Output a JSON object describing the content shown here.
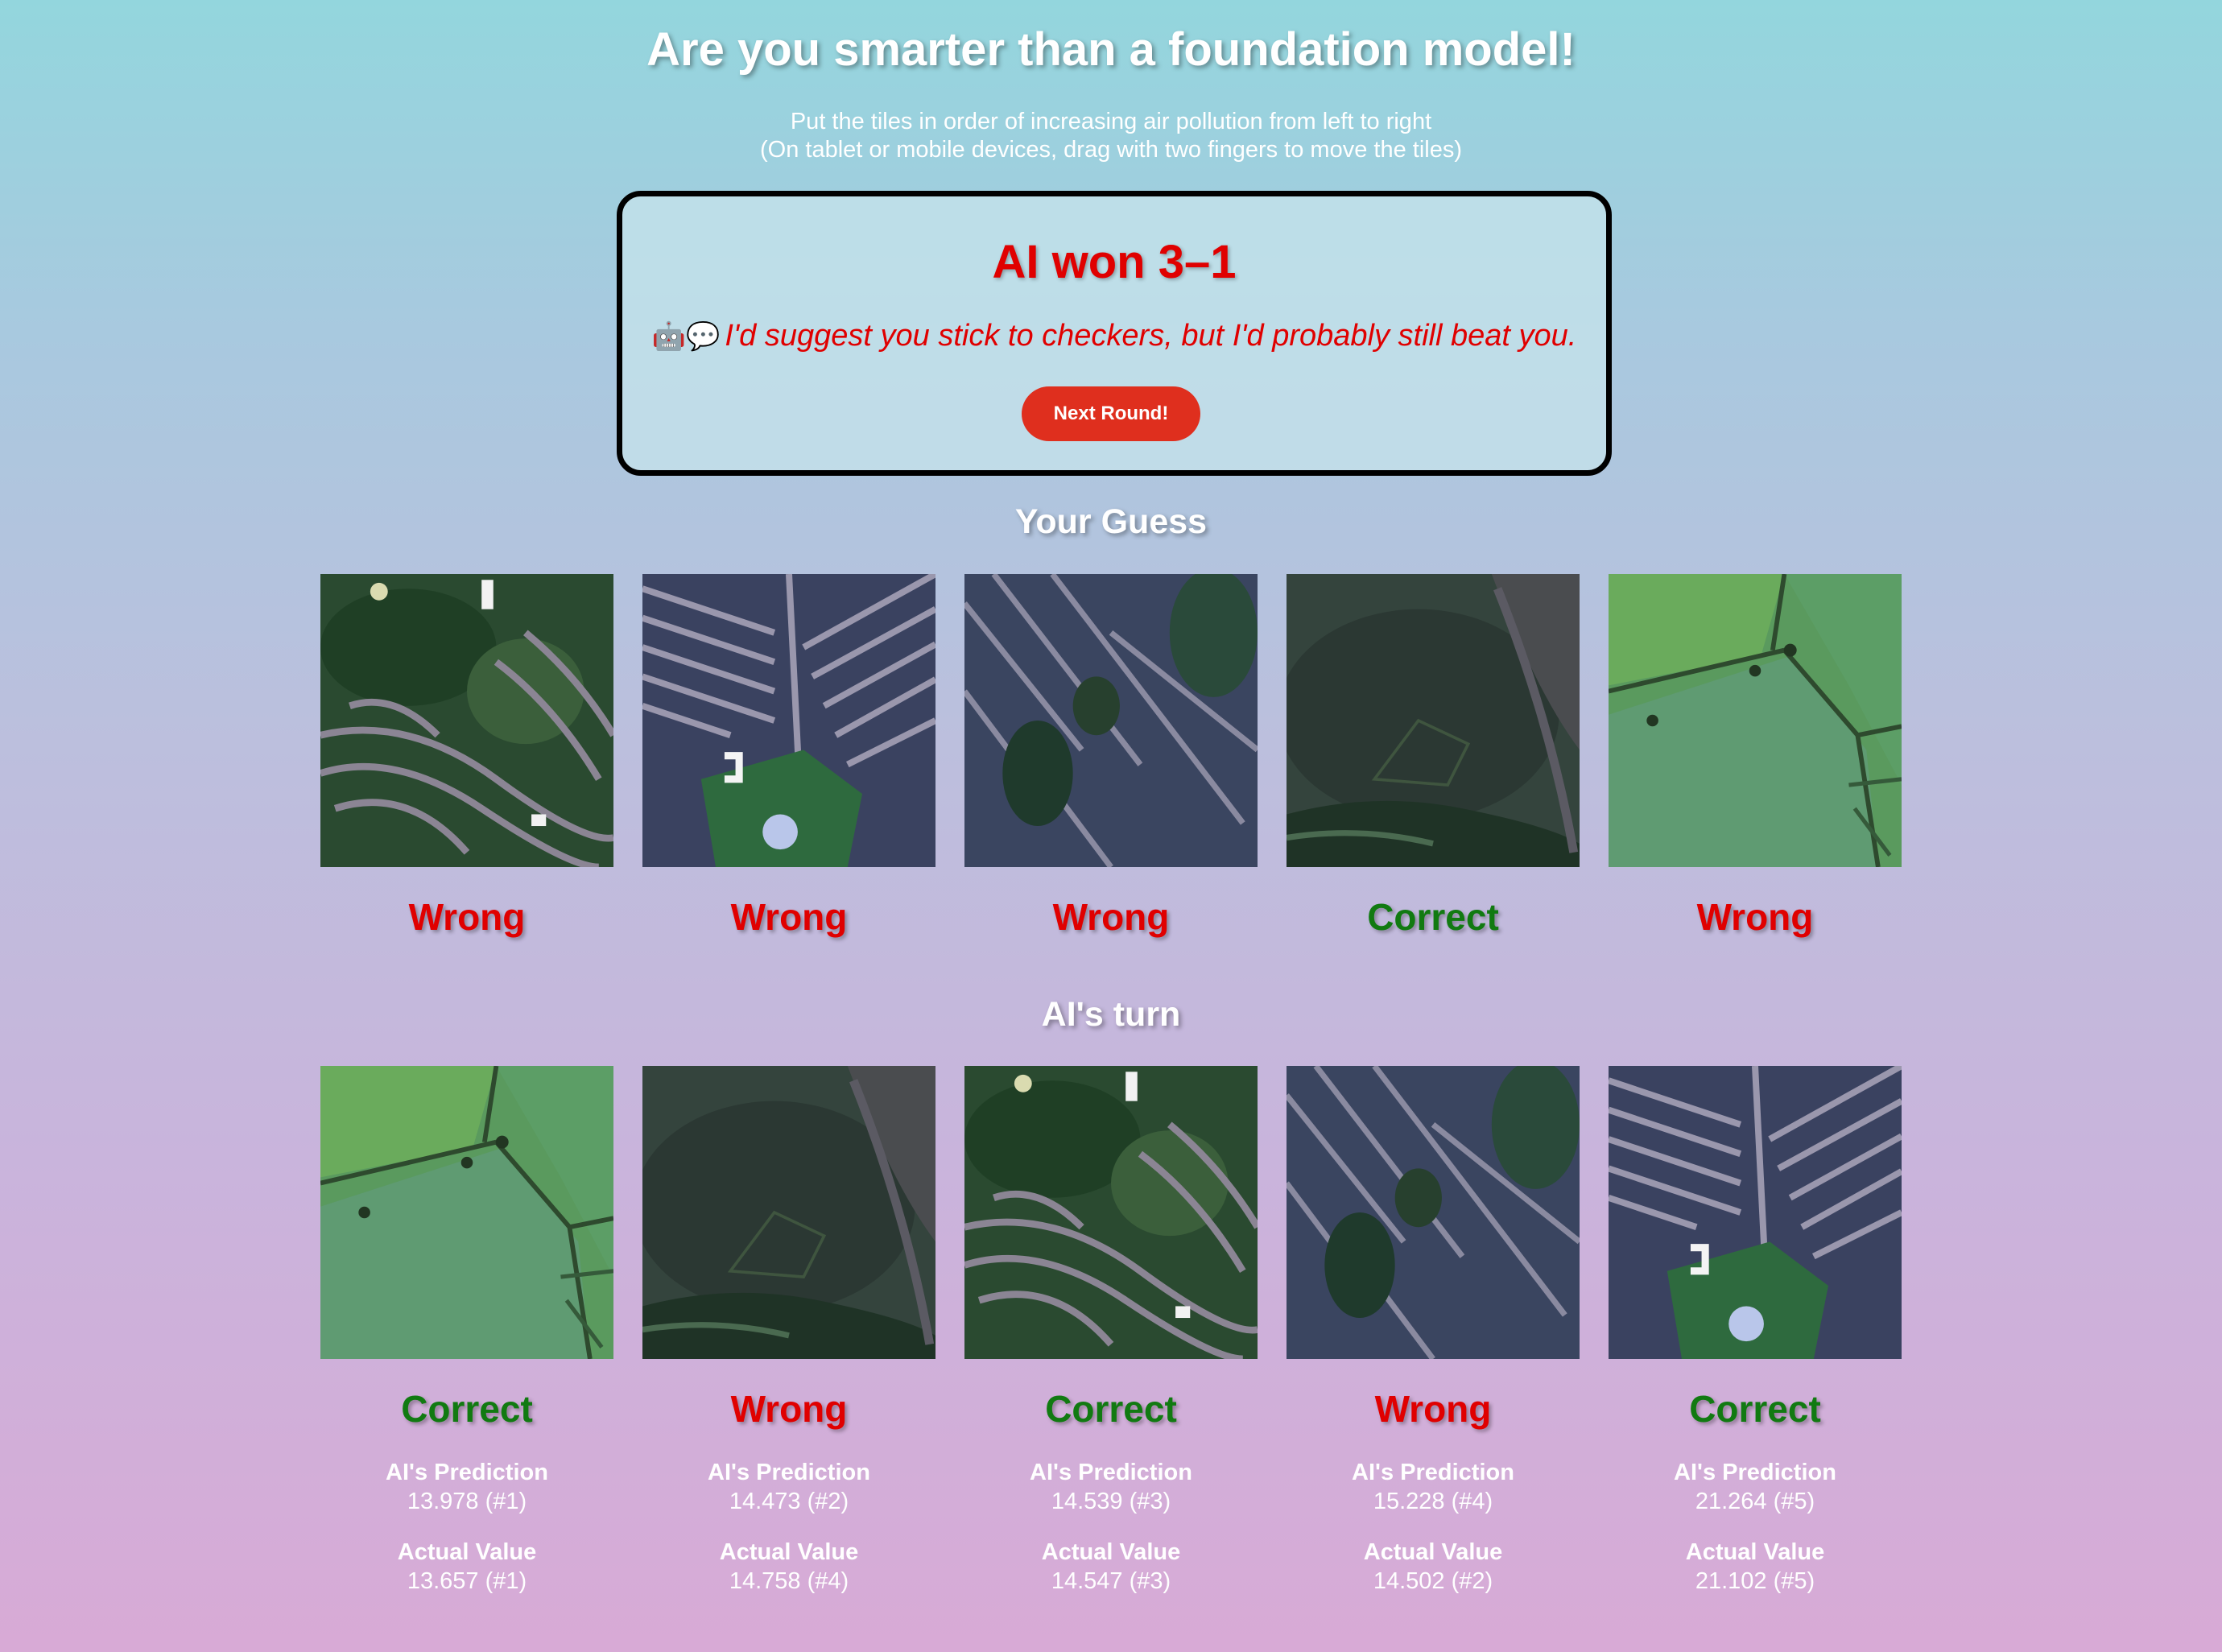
{
  "title": "Are you smarter than a foundation model!",
  "subtitle_line1": "Put the tiles in order of increasing air pollution from left to right",
  "subtitle_line2": "(On tablet or mobile devices, drag with two fingers to move the tiles)",
  "result": {
    "heading": "AI won 3–1",
    "emoji": "🤖💬",
    "taunt": "I'd suggest you stick to checkers, but I'd probably still beat you.",
    "button_label": "Next Round!"
  },
  "your_guess": {
    "heading": "Your Guess",
    "tiles": [
      {
        "image": "suburban-roads-green",
        "verdict": "Wrong"
      },
      {
        "image": "dense-housing-rows-park",
        "verdict": "Wrong"
      },
      {
        "image": "housing-diagonal-streets",
        "verdict": "Wrong"
      },
      {
        "image": "dark-field",
        "verdict": "Correct"
      },
      {
        "image": "green-fields",
        "verdict": "Wrong"
      }
    ]
  },
  "ai_turn": {
    "heading": "AI's turn",
    "prediction_label": "AI's Prediction",
    "actual_label": "Actual Value",
    "tiles": [
      {
        "image": "green-fields",
        "verdict": "Correct",
        "prediction": "13.978 (#1)",
        "actual": "13.657 (#1)"
      },
      {
        "image": "dark-field",
        "verdict": "Wrong",
        "prediction": "14.473 (#2)",
        "actual": "14.758 (#4)"
      },
      {
        "image": "suburban-roads-green",
        "verdict": "Correct",
        "prediction": "14.539 (#3)",
        "actual": "14.547 (#3)"
      },
      {
        "image": "housing-diagonal-streets",
        "verdict": "Wrong",
        "prediction": "15.228 (#4)",
        "actual": "14.502 (#2)"
      },
      {
        "image": "dense-housing-rows-park",
        "verdict": "Correct",
        "prediction": "21.264 (#5)",
        "actual": "21.102 (#5)"
      }
    ]
  },
  "colors": {
    "wrong": "#e00000",
    "correct": "#117a11",
    "button": "#df2f1e"
  }
}
